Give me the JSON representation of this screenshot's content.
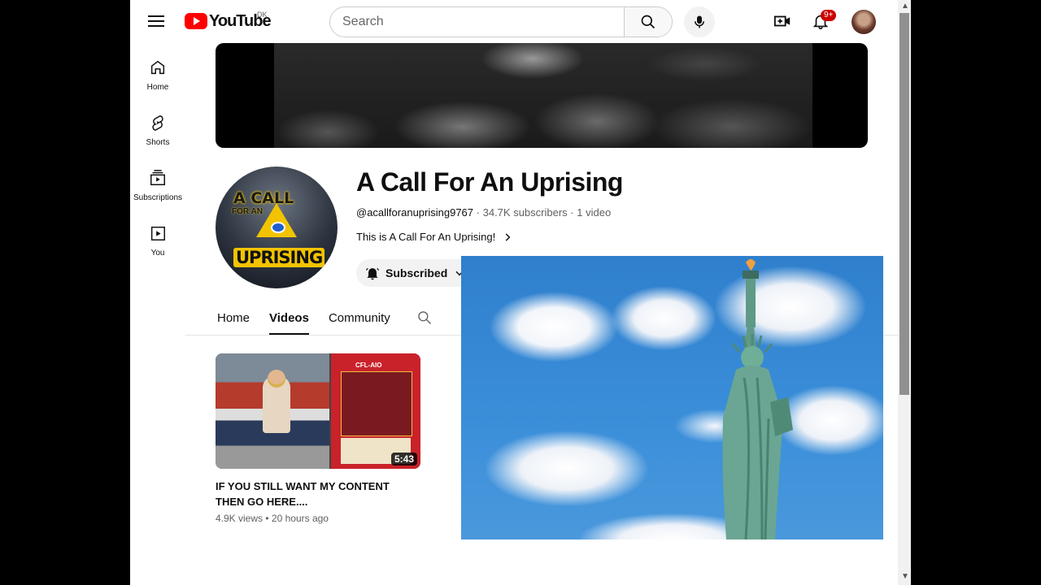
{
  "topbar": {
    "logo_text": "YouTube",
    "region": "DK",
    "search_placeholder": "Search",
    "notification_count": "9+"
  },
  "sidebar": {
    "items": [
      {
        "label": "Home",
        "icon": "home-icon"
      },
      {
        "label": "Shorts",
        "icon": "shorts-icon"
      },
      {
        "label": "Subscriptions",
        "icon": "subscriptions-icon"
      },
      {
        "label": "You",
        "icon": "you-icon"
      }
    ]
  },
  "channel": {
    "name": "A Call For An Uprising",
    "handle": "@acallforanuprising9767",
    "subscribers": "34.7K subscribers",
    "videos": "1 video",
    "separator": "·",
    "description": "This is A Call For An Uprising!",
    "subscribe_label": "Subscribed",
    "avatar_text": {
      "line1": "A CALL",
      "line2": "FOR AN",
      "line3": "UPRISING"
    }
  },
  "tabs": [
    {
      "label": "Home",
      "active": false
    },
    {
      "label": "Videos",
      "active": true
    },
    {
      "label": "Community",
      "active": false
    }
  ],
  "videos": [
    {
      "title": "IF YOU STILL WANT MY CONTENT THEN GO HERE....",
      "views": "4.9K views",
      "age": "20 hours ago",
      "meta_separator": "•",
      "duration": "5:43",
      "thumb_card_title": "CFL-AIO"
    }
  ],
  "colors": {
    "brand_red": "#ff0000",
    "badge_red": "#cc0000",
    "text_primary": "#0f0f0f",
    "text_secondary": "#606060"
  }
}
